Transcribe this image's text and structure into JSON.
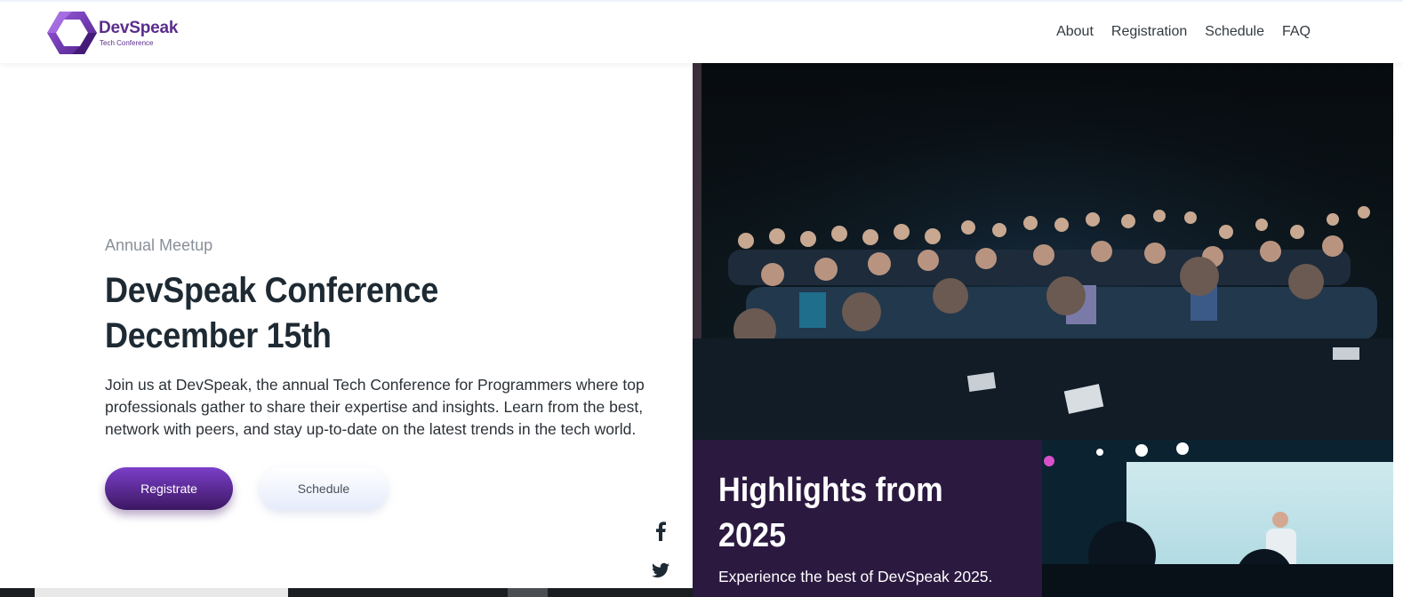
{
  "brand": {
    "name": "DevSpeak",
    "tagline": "Tech Conference"
  },
  "nav": [
    {
      "label": "About"
    },
    {
      "label": "Registration"
    },
    {
      "label": "Schedule"
    },
    {
      "label": "FAQ"
    }
  ],
  "hero": {
    "eyebrow": "Annual Meetup",
    "title_line1": "DevSpeak Conference",
    "title_line2": "December 15th",
    "description": "Join us at DevSpeak, the annual Tech Conference for Programmers where top professionals gather to share their expertise and insights. Learn from the best, network with peers, and stay up-to-date on the latest trends in the tech world.",
    "primary_button": "Registrate",
    "secondary_button": "Schedule"
  },
  "social": [
    {
      "icon": "facebook-icon"
    },
    {
      "icon": "twitter-icon"
    }
  ],
  "highlights": {
    "title_line1": "Highlights from",
    "title_line2": "2025",
    "subtitle": "Experience the best of DevSpeak 2025."
  },
  "colors": {
    "brand_purple": "#5a2d8c",
    "button_gradient_top": "#7b3fc9",
    "button_gradient_bottom": "#3c1762",
    "highlight_bg": "#2b1940",
    "heading": "#1e2a33"
  }
}
